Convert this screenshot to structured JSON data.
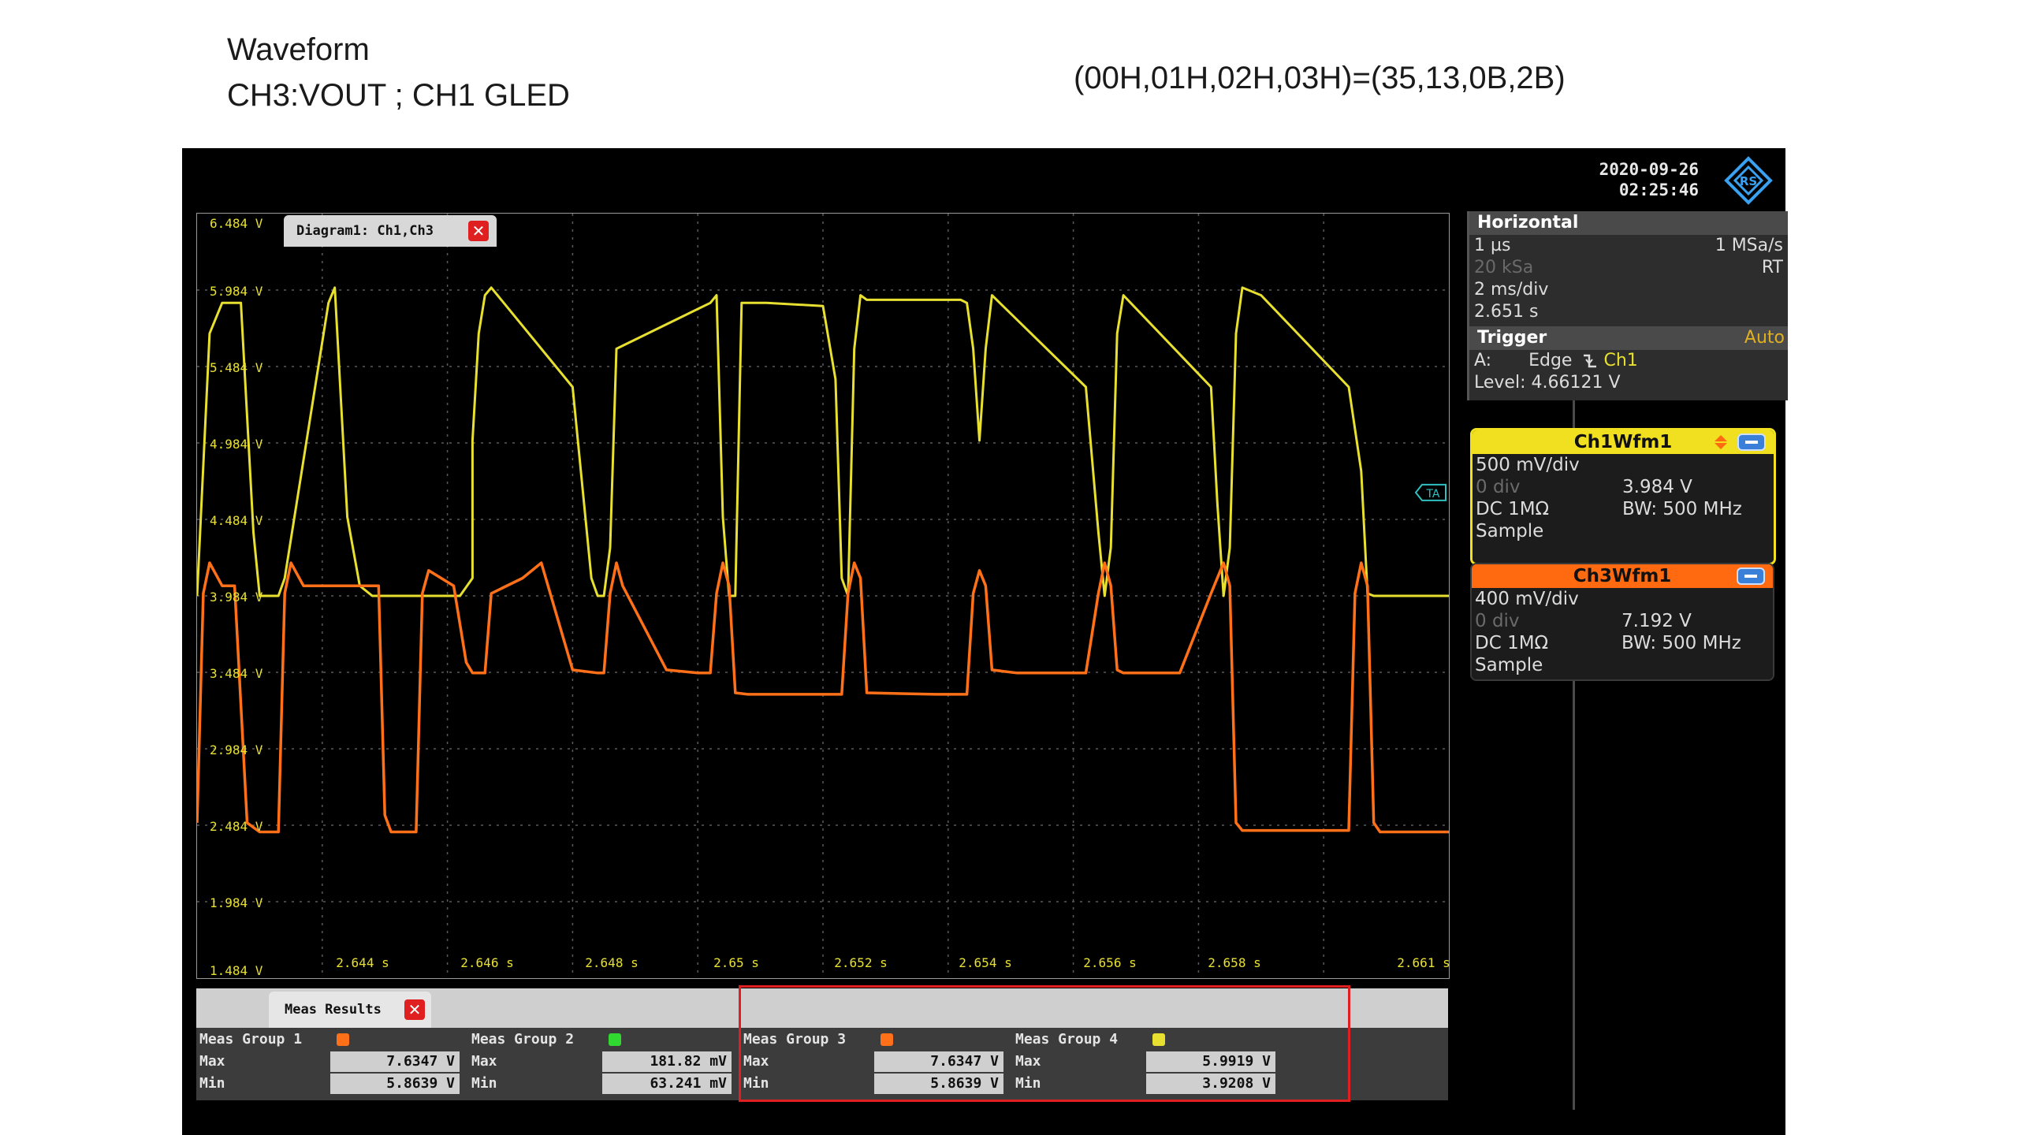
{
  "slide": {
    "title_line1": "Waveform",
    "title_line2": "CH3:VOUT ; CH1 GLED",
    "register_note": "(00H,01H,02H,03H)=(35,13,0B,2B)"
  },
  "scope": {
    "date": "2020-09-26",
    "time": "02:25:46",
    "logo_icon": "rohde-schwarz-logo-icon",
    "diagram_tab_label": "Diagram1: Ch1,Ch3",
    "y_labels": [
      "6.484 V",
      "5.984 V",
      "5.484 V",
      "4.984 V",
      "4.484 V",
      "3.984 V",
      "3.484 V",
      "2.984 V",
      "2.484 V",
      "1.984 V",
      "1.484 V"
    ],
    "x_labels": [
      "2.644 s",
      "2.646 s",
      "2.648 s",
      "2.65 s",
      "2.652 s",
      "2.654 s",
      "2.656 s",
      "2.658 s",
      "2.661 s"
    ],
    "trigger_marker": "TA",
    "colors": {
      "ch1": "#e8e030",
      "ch3": "#ff7018",
      "grid": "#5a5a5a",
      "highlight": "#e02020"
    }
  },
  "chart_data": {
    "type": "line",
    "x_unit": "s",
    "y_unit": "V",
    "xlim": [
      2.6414,
      2.6614
    ],
    "ylim": [
      1.484,
      6.484
    ],
    "grid": true,
    "series": [
      {
        "name": "Ch1Wfm1",
        "x": [
          2.6414,
          2.6416,
          2.6418,
          2.6421,
          2.6423,
          2.6424,
          2.6425,
          2.6427,
          2.6428,
          2.6435,
          2.6436,
          2.6438,
          2.644,
          2.6442,
          2.6443,
          2.6444,
          2.6448,
          2.6456,
          2.6458,
          2.6458,
          2.6459,
          2.646,
          2.6461,
          2.6474,
          2.6477,
          2.6478,
          2.6479,
          2.648,
          2.6481,
          2.6496,
          2.6497,
          2.6498,
          2.6499,
          2.65,
          2.6501,
          2.6505,
          2.6514,
          2.6516,
          2.6517,
          2.6518,
          2.6519,
          2.652,
          2.6521,
          2.6536,
          2.6537,
          2.6538,
          2.6539,
          2.654,
          2.6541,
          2.6556,
          2.6558,
          2.6559,
          2.656,
          2.6561,
          2.6562,
          2.6576,
          2.6577,
          2.6578,
          2.6579,
          2.658,
          2.6581,
          2.6584,
          2.6598,
          2.66,
          2.6601,
          2.6602,
          2.6603,
          2.6605,
          2.6614
        ],
        "y": [
          3.984,
          5.7,
          5.9,
          5.9,
          4.4,
          3.984,
          3.984,
          3.984,
          4.1,
          5.9,
          6.0,
          4.5,
          4.05,
          3.984,
          3.984,
          3.984,
          3.984,
          3.984,
          4.1,
          5.0,
          5.7,
          5.95,
          6.0,
          5.35,
          4.1,
          3.984,
          3.984,
          4.3,
          5.6,
          5.9,
          5.95,
          4.5,
          3.984,
          3.984,
          5.9,
          5.9,
          5.88,
          5.4,
          4.1,
          3.984,
          5.6,
          5.95,
          5.92,
          5.92,
          5.9,
          5.6,
          5.0,
          5.6,
          5.95,
          5.35,
          4.4,
          3.984,
          4.3,
          5.7,
          5.95,
          5.35,
          4.6,
          3.984,
          4.3,
          5.7,
          6.0,
          5.95,
          5.35,
          4.8,
          4.0,
          3.984,
          3.984,
          3.984,
          3.984
        ]
      },
      {
        "name": "Ch3Wfm1",
        "x": [
          2.6414,
          2.6415,
          2.6416,
          2.6418,
          2.642,
          2.6422,
          2.6424,
          2.6426,
          2.6427,
          2.6428,
          2.6429,
          2.6431,
          2.6443,
          2.6444,
          2.6445,
          2.6448,
          2.6449,
          2.645,
          2.6451,
          2.6455,
          2.6457,
          2.6458,
          2.646,
          2.6461,
          2.6466,
          2.6469,
          2.6474,
          2.6478,
          2.6479,
          2.648,
          2.6481,
          2.6482,
          2.6489,
          2.6494,
          2.6496,
          2.6497,
          2.6498,
          2.6499,
          2.65,
          2.6502,
          2.6505,
          2.6512,
          2.6516,
          2.6517,
          2.6518,
          2.6519,
          2.652,
          2.6521,
          2.6532,
          2.6537,
          2.6538,
          2.6539,
          2.654,
          2.6541,
          2.6545,
          2.6553,
          2.6556,
          2.6558,
          2.6559,
          2.656,
          2.6561,
          2.6562,
          2.6564,
          2.6571,
          2.6576,
          2.6578,
          2.6579,
          2.658,
          2.6581,
          2.6582,
          2.6584,
          2.6585,
          2.6586,
          2.6587,
          2.6588,
          2.6589,
          2.659,
          2.6598,
          2.6599,
          2.66,
          2.6601,
          2.6602,
          2.6603,
          2.6605,
          2.6614
        ],
        "y": [
          2.5,
          4.0,
          4.2,
          4.05,
          4.05,
          2.5,
          2.44,
          2.44,
          2.44,
          4.0,
          4.2,
          4.05,
          4.05,
          2.55,
          2.44,
          2.44,
          2.44,
          4.0,
          4.15,
          4.05,
          3.55,
          3.48,
          3.48,
          4.0,
          4.1,
          4.2,
          3.5,
          3.48,
          3.48,
          4.0,
          4.2,
          4.05,
          3.5,
          3.48,
          3.48,
          4.0,
          4.2,
          4.05,
          3.35,
          3.34,
          3.34,
          3.34,
          3.34,
          3.34,
          4.0,
          4.2,
          4.1,
          3.35,
          3.34,
          3.34,
          4.0,
          4.15,
          4.05,
          3.5,
          3.48,
          3.48,
          3.48,
          4.0,
          4.2,
          4.05,
          3.5,
          3.48,
          3.48,
          3.48,
          4.0,
          4.2,
          4.05,
          2.5,
          2.45,
          2.45,
          2.45,
          2.45,
          2.45,
          2.45,
          2.45,
          2.45,
          2.45,
          2.45,
          4.0,
          4.2,
          4.05,
          2.5,
          2.44,
          2.44,
          2.44
        ]
      }
    ]
  },
  "meas_results": {
    "tab_label": "Meas Results",
    "groups": [
      {
        "title": "Meas Group 1",
        "color": "#ff7018",
        "max_label": "Max",
        "max": "7.6347 V",
        "min_label": "Min",
        "min": "5.8639 V"
      },
      {
        "title": "Meas Group 2",
        "color": "#30d830",
        "max_label": "Max",
        "max": "181.82 mV",
        "min_label": "Min",
        "min": "63.241 mV"
      },
      {
        "title": "Meas Group 3",
        "color": "#ff7018",
        "max_label": "Max",
        "max": "7.6347 V",
        "min_label": "Min",
        "min": "5.8639 V"
      },
      {
        "title": "Meas Group 4",
        "color": "#e8e030",
        "max_label": "Max",
        "max": "5.9919 V",
        "min_label": "Min",
        "min": "3.9208 V"
      }
    ]
  },
  "horizontal": {
    "header": "Horizontal",
    "resolution": "1 µs",
    "sample_rate": "1 MSa/s",
    "record_length": "20 kSa",
    "mode": "RT",
    "time_scale": "2 ms/div",
    "position": "2.651 s"
  },
  "trigger": {
    "header": "Trigger",
    "mode": "Auto",
    "source_prefix": "A:",
    "type": "Edge",
    "slope_icon": "falling-edge-icon",
    "source": "Ch1",
    "level": "Level: 4.66121 V"
  },
  "channels": [
    {
      "title": "Ch1Wfm1",
      "scale": "500 mV/div",
      "offset": "0 div",
      "offset_value": "3.984 V",
      "coupling": "DC 1MΩ",
      "bandwidth": "BW: 500 MHz",
      "acq": "Sample",
      "color": "#f0e020"
    },
    {
      "title": "Ch3Wfm1",
      "scale": "400 mV/div",
      "offset": "0 div",
      "offset_value": "7.192 V",
      "coupling": "DC 1MΩ",
      "bandwidth": "BW: 500 MHz",
      "acq": "Sample",
      "color": "#ff6a10"
    }
  ]
}
